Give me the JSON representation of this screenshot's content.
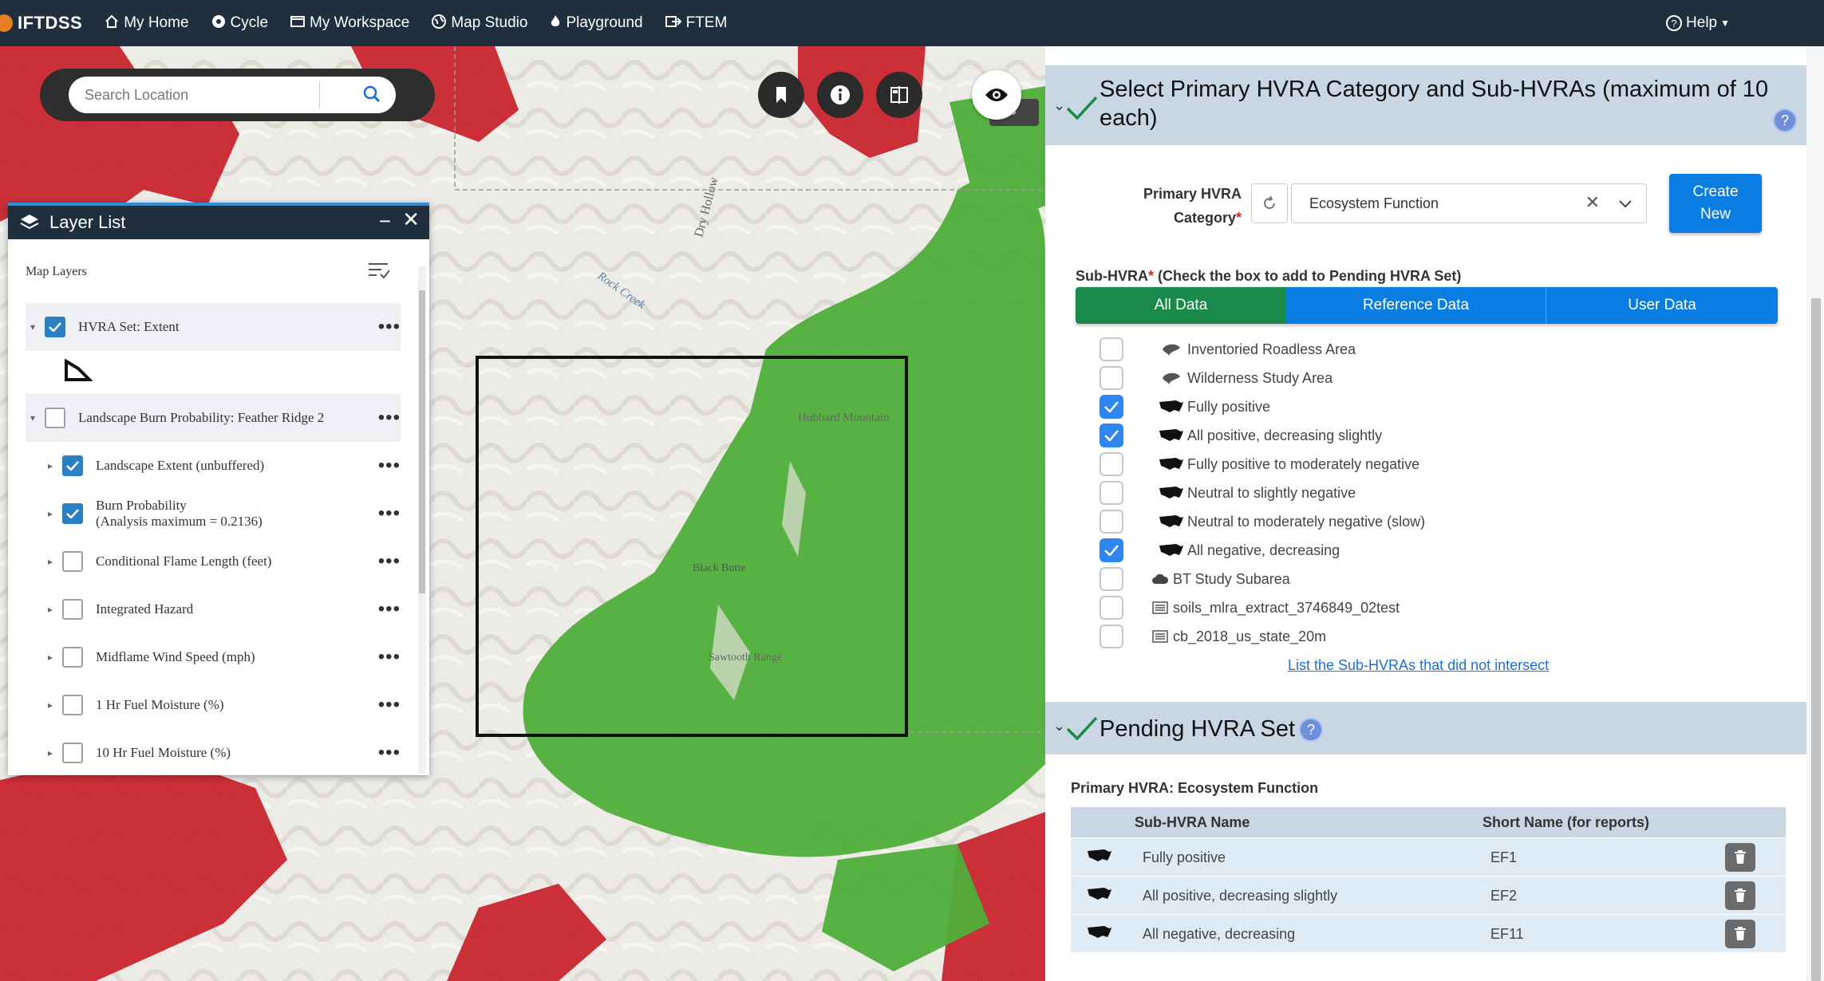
{
  "nav": {
    "brand": "IFTDSS",
    "items": [
      {
        "label": "My Home",
        "icon": "home-icon"
      },
      {
        "label": "Cycle",
        "icon": "cycle-icon"
      },
      {
        "label": "My Workspace",
        "icon": "workspace-icon"
      },
      {
        "label": "Map Studio",
        "icon": "globe-icon"
      },
      {
        "label": "Playground",
        "icon": "flame-icon"
      },
      {
        "label": "FTEM",
        "icon": "export-icon"
      }
    ],
    "help": "Help"
  },
  "map": {
    "search_placeholder": "Search Location",
    "labels": [
      "Dry Hollow",
      "Rock Creek",
      "Hubbard Mountain",
      "Black Butte",
      "Sawtooth Range"
    ],
    "colors": {
      "burn_high": "#c8202a",
      "burn_low": "#4fae3a"
    }
  },
  "layer_list": {
    "title": "Layer List",
    "subtitle": "Map Layers",
    "layers": [
      {
        "label": "HVRA Set: Extent",
        "checked": true
      },
      {
        "label": "Landscape Burn Probability: Feather Ridge 2",
        "checked": false
      },
      {
        "label": "Landscape Extent (unbuffered)",
        "checked": true
      },
      {
        "label": "Burn Probability",
        "label2": "(Analysis maximum = 0.2136)",
        "checked": true
      },
      {
        "label": "Conditional Flame Length (feet)",
        "checked": false
      },
      {
        "label": "Integrated Hazard",
        "checked": false
      },
      {
        "label": "Midflame Wind Speed (mph)",
        "checked": false
      },
      {
        "label": "1 Hr Fuel Moisture (%)",
        "checked": false
      },
      {
        "label": "10 Hr Fuel Moisture (%)",
        "checked": false
      }
    ]
  },
  "panel": {
    "select_section": {
      "title_line1": "Select Primary HVRA Category and Sub-HVRAs (maximum of 10",
      "title_line2": "each)"
    },
    "primary_label_1": "Primary HVRA",
    "primary_label_2": "Category",
    "primary_value": "Ecosystem Function",
    "create_line1": "Create",
    "create_line2": "New",
    "sub_title": "Sub-HVRA",
    "sub_title_rest": " (Check the box to add to Pending HVRA Set)",
    "tabs": [
      "All Data",
      "Reference Data",
      "User Data"
    ],
    "sub_hvras": [
      {
        "label": "Inventoried Roadless Area",
        "checked": false,
        "icon": "feather-icon"
      },
      {
        "label": "Wilderness Study Area",
        "checked": false,
        "icon": "feather-icon"
      },
      {
        "label": "Fully positive",
        "checked": true,
        "icon": "usa-map-icon"
      },
      {
        "label": "All positive, decreasing slightly",
        "checked": true,
        "icon": "usa-map-icon"
      },
      {
        "label": "Fully positive to moderately negative",
        "checked": false,
        "icon": "usa-map-icon"
      },
      {
        "label": "Neutral to slightly negative",
        "checked": false,
        "icon": "usa-map-icon"
      },
      {
        "label": "Neutral to moderately negative (slow)",
        "checked": false,
        "icon": "usa-map-icon"
      },
      {
        "label": "All negative, decreasing",
        "checked": true,
        "icon": "usa-map-icon"
      },
      {
        "label": "BT Study Subarea",
        "checked": false,
        "icon": "cloud-icon"
      },
      {
        "label": "soils_mlra_extract_3746849_02test",
        "checked": false,
        "icon": "table-icon"
      },
      {
        "label": "cb_2018_us_state_20m",
        "checked": false,
        "icon": "table-icon"
      }
    ],
    "link": "List the Sub-HVRAs that did not intersect",
    "pending": {
      "title": "Pending HVRA Set",
      "primary": "Primary HVRA: Ecosystem Function",
      "col_name": "Sub-HVRA Name",
      "col_short": "Short Name (for reports)",
      "rows": [
        {
          "name": "Fully positive",
          "short": "EF1"
        },
        {
          "name": "All positive, decreasing slightly",
          "short": "EF2"
        },
        {
          "name": "All negative, decreasing",
          "short": "EF11"
        }
      ]
    }
  }
}
